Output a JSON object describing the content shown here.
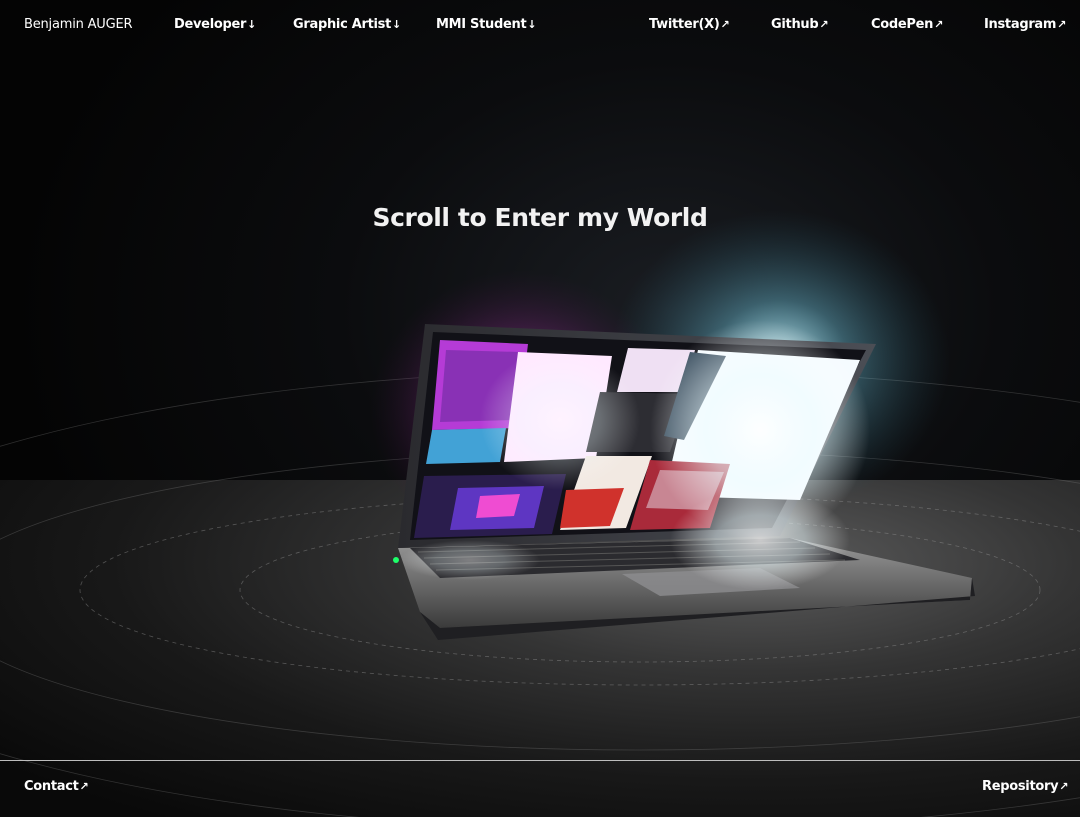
{
  "header": {
    "brand": "Benjamin AUGER",
    "sections": [
      {
        "label": "Developer",
        "arrow": "↓"
      },
      {
        "label": "Graphic Artist",
        "arrow": "↓"
      },
      {
        "label": "MMI Student",
        "arrow": "↓"
      }
    ],
    "socials": [
      {
        "label": "Twitter(X)",
        "arrow": "↗"
      },
      {
        "label": "Github",
        "arrow": "↗"
      },
      {
        "label": "CodePen",
        "arrow": "↗"
      },
      {
        "label": "Instagram",
        "arrow": "↗"
      }
    ]
  },
  "hero": {
    "title": "Scroll to Enter my World"
  },
  "footer": {
    "contact": {
      "label": "Contact",
      "arrow": "↗"
    },
    "repository": {
      "label": "Repository",
      "arrow": "↗"
    }
  },
  "colors": {
    "background": "#050505",
    "text": "#ffffff",
    "screen_glow_magenta": "#ff3df2",
    "screen_glow_cyan": "#8fe9ff"
  }
}
